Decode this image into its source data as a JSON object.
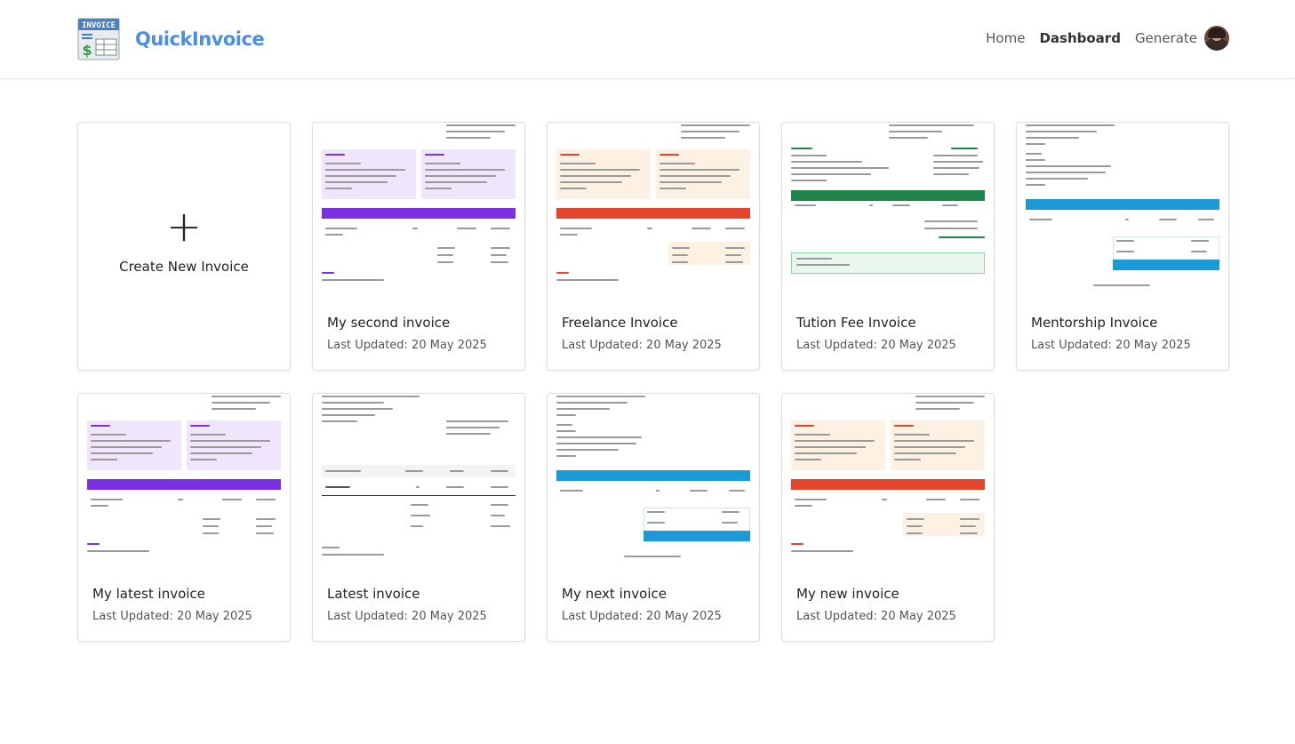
{
  "app": {
    "name": "QuickInvoice",
    "logo_text": "INVOICE",
    "logo_symbol": "$"
  },
  "nav": {
    "items": [
      "Home",
      "Dashboard",
      "Generate"
    ],
    "active": "Dashboard"
  },
  "create_card": {
    "icon": "plus-icon",
    "symbol": "+",
    "label": "Create New Invoice"
  },
  "invoices": [
    {
      "title": "My second invoice",
      "updated": "Last Updated: 20 May 2025",
      "accent": "#7b2fe0",
      "style": "purple"
    },
    {
      "title": "Freelance Invoice",
      "updated": "Last Updated: 20 May 2025",
      "accent": "#e3452c",
      "style": "orange"
    },
    {
      "title": "Tution Fee Invoice",
      "updated": "Last Updated: 20 May 2025",
      "accent": "#1e8449",
      "style": "green"
    },
    {
      "title": "Mentorship Invoice",
      "updated": "Last Updated: 20 May 2025",
      "accent": "#1a9ad6",
      "style": "blue"
    },
    {
      "title": "My latest invoice",
      "updated": "Last Updated: 20 May 2025",
      "accent": "#7b2fe0",
      "style": "purple"
    },
    {
      "title": "Latest invoice",
      "updated": "Last Updated: 20 May 2025",
      "accent": "#222222",
      "style": "mono"
    },
    {
      "title": "My next invoice",
      "updated": "Last Updated: 20 May 2025",
      "accent": "#1a9ad6",
      "style": "blue"
    },
    {
      "title": "My new invoice",
      "updated": "Last Updated: 20 May 2025",
      "accent": "#e3452c",
      "style": "orange"
    }
  ],
  "colors": {
    "brand": "#4a8fe7",
    "purple": "#7b2fe0",
    "orange": "#e3452c",
    "green": "#1e8449",
    "blue": "#1a9ad6"
  }
}
